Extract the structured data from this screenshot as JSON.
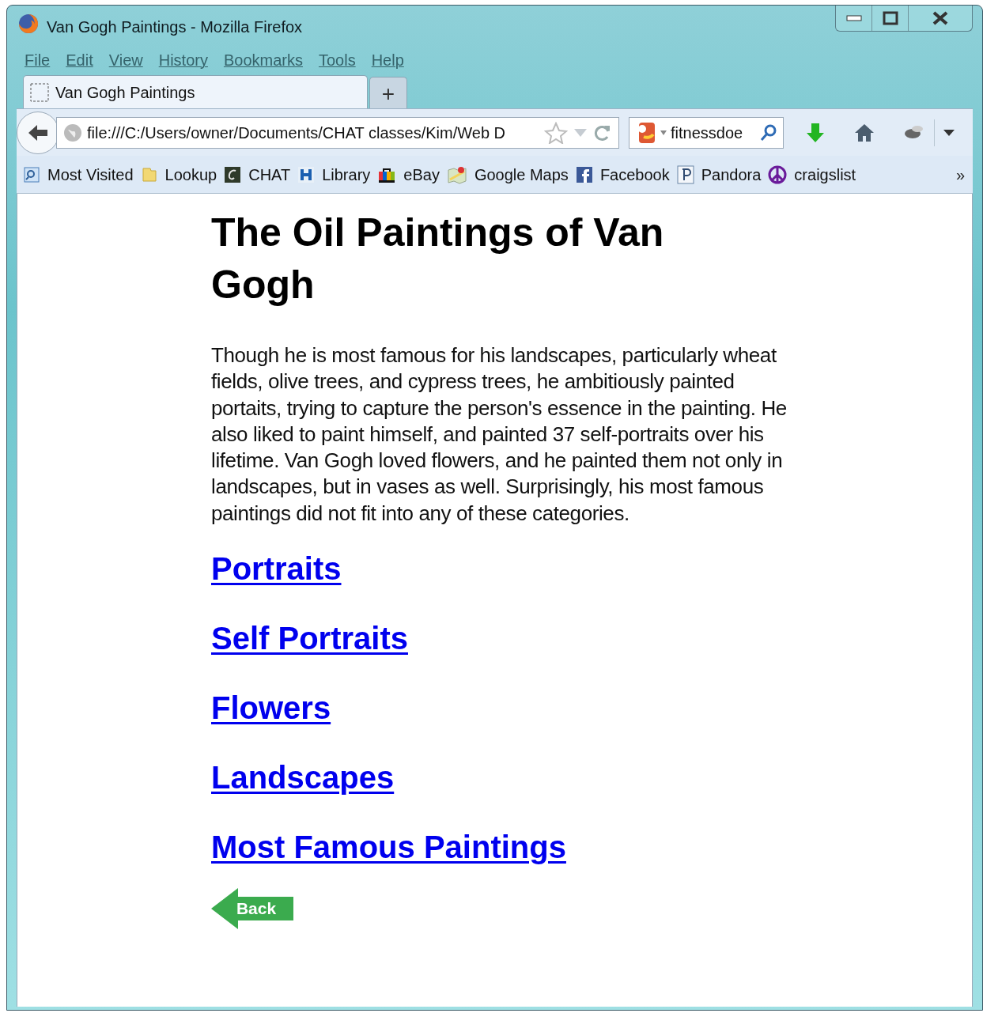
{
  "window": {
    "title": "Van Gogh Paintings - Mozilla Firefox"
  },
  "menu": [
    "File",
    "Edit",
    "View",
    "History",
    "Bookmarks",
    "Tools",
    "Help"
  ],
  "tabs": [
    {
      "label": "Van Gogh Paintings",
      "selected": true
    }
  ],
  "new_tab": "+",
  "address": {
    "value": "file:///C:/Users/owner/Documents/CHAT classes/Kim/Web D"
  },
  "search": {
    "value": "fitnessdoe"
  },
  "bookmarks": [
    {
      "label": "Most Visited",
      "kind": "folder-search"
    },
    {
      "label": "Lookup",
      "kind": "folder"
    },
    {
      "label": "CHAT",
      "kind": "chat"
    },
    {
      "label": "Library",
      "kind": "library"
    },
    {
      "label": "eBay",
      "kind": "bag"
    },
    {
      "label": "Google Maps",
      "kind": "map"
    },
    {
      "label": "Facebook",
      "kind": "facebook"
    },
    {
      "label": "Pandora",
      "kind": "pandora"
    },
    {
      "label": "craigslist",
      "kind": "peace"
    }
  ],
  "bookmarks_more": "»",
  "page": {
    "heading": "The Oil Paintings of Van Gogh",
    "paragraph": "Though he is most famous for his landscapes, particularly wheat fields, olive trees, and cypress trees, he ambitiously painted portaits, trying to capture the person's essence in the painting. He also liked to paint himself, and painted 37 self-portraits over his lifetime. Van Gogh loved flowers, and he painted them not only in landscapes, but in vases as well. Surprisingly, his most famous paintings did not fit into any of these categories.",
    "links": [
      "Portraits",
      "Self Portraits",
      "Flowers",
      "Landscapes",
      "Most Famous Paintings"
    ],
    "back_button": "Back"
  }
}
